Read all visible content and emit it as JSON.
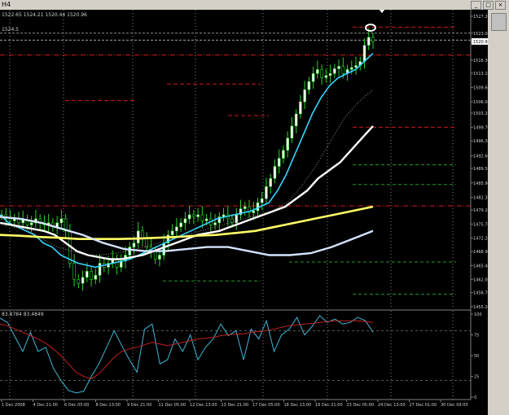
{
  "window": {
    "title": "H4",
    "buttons": [
      "_",
      "□",
      "×"
    ]
  },
  "main_chart": {
    "ohlc_readout": "1522.65 1524.21 1520.44 1520.96",
    "price_marker": "1520.96",
    "level_label": "1524.5"
  },
  "oscillator": {
    "readout": "83.8784 83.4849"
  },
  "chart_data": [
    {
      "type": "candlestick",
      "title": "",
      "ylim": [
        1455.2,
        1527.2
      ],
      "y_ticks": [
        "1527.20",
        "1523.00",
        "1520.96",
        "1516.30",
        "1513.10",
        "1509.60",
        "1506.00",
        "1503.20",
        "1499.70",
        "1496.30",
        "1492.60",
        "1489.50",
        "1485.90",
        "1482.30",
        "1479.20",
        "1475.70",
        "1472.20",
        "1468.90",
        "1465.40",
        "1462.00",
        "1458.70",
        "1455.20"
      ],
      "x_tick_labels": [
        "1 Dec 2008",
        "4 Dec 21:00",
        "6 Dec 05:00",
        "8 Dec 13:00",
        "9 Dec 21:00",
        "11 Dec 05:00",
        "12 Dec 13:00",
        "13 Dec 21:00",
        "17 Dec 05:00",
        "18 Dec 13:00",
        "19 Dec 21:00",
        "23 Dec 05:00",
        "24 Dec 13:00",
        "27 Dec 01:00",
        "30 Dec 09:00"
      ],
      "close": [
        1478,
        1477,
        1476.5,
        1477,
        1476,
        1476.8,
        1475.5,
        1476,
        1477,
        1476.2,
        1475.5,
        1476,
        1475,
        1476,
        1477,
        1474,
        1466,
        1462,
        1461,
        1462.5,
        1464,
        1462,
        1463,
        1466,
        1465,
        1466,
        1467,
        1465,
        1466.5,
        1468,
        1470,
        1471,
        1474,
        1472,
        1470,
        1469,
        1467,
        1468,
        1471,
        1473,
        1474,
        1475,
        1476,
        1477,
        1478,
        1477.5,
        1478,
        1476.5,
        1477,
        1475.5,
        1476,
        1477.5,
        1478,
        1477,
        1476,
        1478,
        1479.5,
        1480,
        1478.5,
        1479,
        1481,
        1482,
        1485,
        1487,
        1490,
        1492,
        1494,
        1497,
        1500,
        1503,
        1506,
        1509,
        1511,
        1513,
        1514,
        1512,
        1512.5,
        1513,
        1514.2,
        1514.8,
        1513,
        1514,
        1514.5,
        1515,
        1516,
        1520,
        1522,
        1520.96
      ],
      "series": [
        {
          "name": "",
          "color": "#35d7ff",
          "values": [
            1478,
            1476,
            1475,
            1474,
            1473,
            1471,
            1470,
            1468,
            1467,
            1466,
            1465.5,
            1465,
            1465.5,
            1466,
            1466.5,
            1467,
            1468,
            1469,
            1470,
            1471,
            1472,
            1473,
            1474,
            1475,
            1476,
            1477,
            1477.5,
            1478,
            1478.5,
            1479,
            1480,
            1481,
            1484,
            1488,
            1493,
            1498,
            1503,
            1507,
            1510,
            1512,
            1513,
            1514,
            1516,
            1518
          ]
        },
        {
          "name": "",
          "color": "#ffffff",
          "values": [
            1476,
            1475.5,
            1475,
            1474.5,
            1474,
            1473,
            1471,
            1469,
            1468,
            1467.5,
            1467,
            1467,
            1467.5,
            1468,
            1469,
            1470,
            1471,
            1472,
            1473,
            1473.5,
            1474,
            1475,
            1476,
            1477,
            1478,
            1479,
            1480,
            1482,
            1484,
            1487,
            1489,
            1491,
            1494,
            1497,
            1500
          ]
        },
        {
          "name": "",
          "color": "#ffff66",
          "values": [
            1473,
            1472.8,
            1472.5,
            1472.3,
            1472,
            1472,
            1472,
            1472.1,
            1472.3,
            1472.5,
            1472.8,
            1473,
            1473.5,
            1474,
            1475,
            1476,
            1477,
            1478,
            1479,
            1480
          ]
        },
        {
          "name": "",
          "color": "#d6e4ff",
          "values": [
            1477.5,
            1477,
            1476,
            1474.5,
            1473,
            1471,
            1469.5,
            1469,
            1469,
            1469.5,
            1470,
            1470,
            1469,
            1468,
            1468,
            1468.5,
            1470,
            1472,
            1474
          ]
        }
      ],
      "levels_red": [
        1524.5,
        1517.6,
        1510.4,
        1506.3,
        1502.6,
        1499.7,
        1480.2
      ],
      "levels_green": [
        1490.4,
        1485.5,
        1466.3,
        1461.6,
        1458.3
      ],
      "grid": true,
      "background": "#000000"
    },
    {
      "type": "line",
      "title": "",
      "ylim": [
        0,
        100
      ],
      "y_ticks": [
        "100",
        "75",
        "50",
        "25",
        "0"
      ],
      "series": [
        {
          "name": "",
          "color": "#3fb6d8",
          "values": [
            95,
            90,
            72,
            55,
            78,
            55,
            60,
            35,
            20,
            8,
            5,
            7,
            25,
            40,
            60,
            80,
            62,
            45,
            30,
            82,
            88,
            40,
            45,
            70,
            55,
            75,
            45,
            60,
            70,
            88,
            74,
            80,
            45,
            82,
            70,
            92,
            55,
            75,
            82,
            96,
            75,
            85,
            98,
            90,
            94,
            88,
            90,
            96,
            92,
            78
          ]
        },
        {
          "name": "",
          "color": "#c02020",
          "values": [
            88,
            86,
            82,
            78,
            74,
            70,
            65,
            58,
            50,
            40,
            30,
            25,
            22,
            28,
            38,
            48,
            55,
            58,
            60,
            63,
            66,
            64,
            62,
            64,
            66,
            68,
            70,
            71,
            72,
            74,
            75,
            76,
            76,
            78,
            79,
            80,
            82,
            84,
            86,
            87,
            88,
            89,
            90,
            91,
            92,
            92,
            92,
            92,
            91,
            90
          ]
        }
      ],
      "levels_dashed": [
        80,
        20
      ],
      "grid": true,
      "background": "#000000"
    }
  ]
}
